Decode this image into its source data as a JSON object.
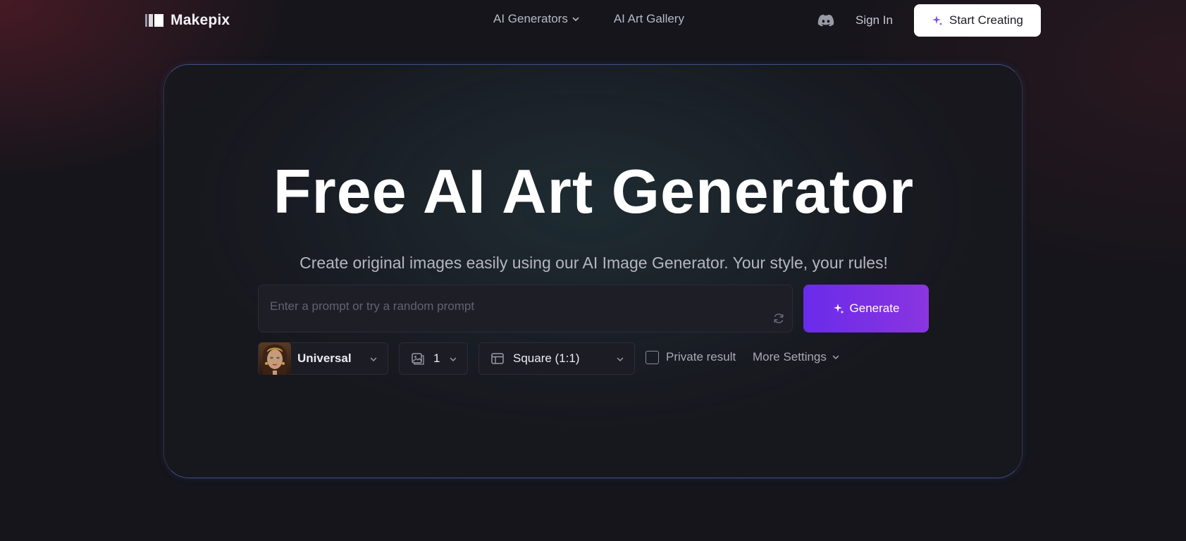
{
  "nav": {
    "brand": "Makepix",
    "links": [
      {
        "label": "AI Generators",
        "has_dropdown": true
      },
      {
        "label": "AI Art Gallery",
        "has_dropdown": false
      }
    ],
    "discord_icon": "discord-icon",
    "sign_in": "Sign In",
    "start_creating": "Start Creating"
  },
  "hero": {
    "title": "Free AI Art Generator",
    "subtitle": "Create original images easily using our AI Image Generator. Your style, your rules!",
    "prompt_placeholder": "Enter a prompt or try a random prompt",
    "prompt_value": "",
    "generate_label": "Generate"
  },
  "controls": {
    "model": "Universal",
    "image_count": "1",
    "aspect_ratio": "Square (1:1)",
    "private_label": "Private result",
    "private_checked": false,
    "more_settings": "More Settings"
  },
  "colors": {
    "background": "#15151b",
    "generate_start": "#6a2bea",
    "generate_end": "#8a35e0",
    "start_button": "#ffffff",
    "sparkle_accent": "#7a4cf0"
  }
}
